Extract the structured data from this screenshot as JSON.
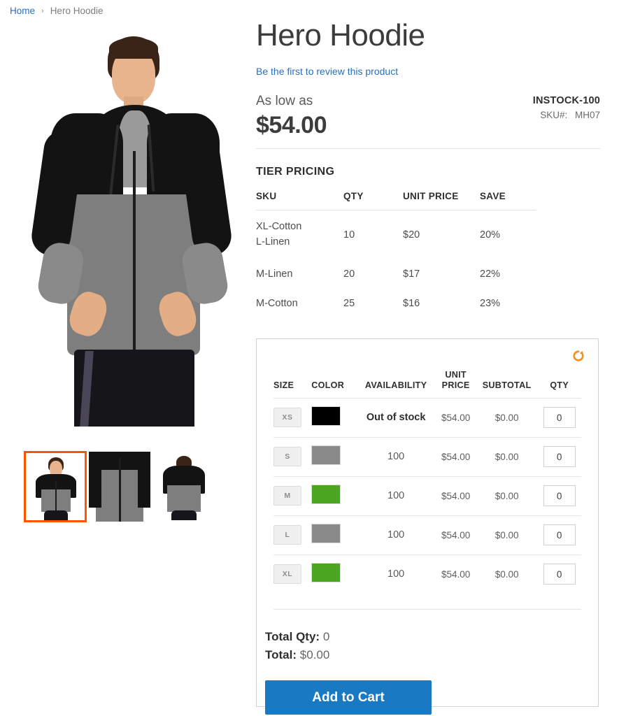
{
  "breadcrumb": {
    "home": "Home",
    "separator": "›",
    "current": "Hero Hoodie"
  },
  "product": {
    "title": "Hero Hoodie",
    "review_link": "Be the first to review this product",
    "as_low_as_label": "As low as",
    "price": "$54.00",
    "stock_status": "INSTOCK-100",
    "sku_key": "SKU#:",
    "sku_value": "MH07"
  },
  "gallery": {
    "thumbnails": [
      {
        "name": "hero-hoodie-front-model",
        "active": true
      },
      {
        "name": "hero-hoodie-detail-zipper",
        "active": false
      },
      {
        "name": "hero-hoodie-back-model",
        "active": false
      }
    ]
  },
  "tier_pricing": {
    "heading": "TIER PRICING",
    "columns": [
      "SKU",
      "QTY",
      "UNIT PRICE",
      "SAVE"
    ],
    "rows": [
      {
        "sku_lines": [
          "XL-Cotton",
          "L-Linen"
        ],
        "qty": "10",
        "unit_price": "$20",
        "save": "20%"
      },
      {
        "sku_lines": [
          "M-Linen"
        ],
        "qty": "20",
        "unit_price": "$17",
        "save": "22%"
      },
      {
        "sku_lines": [
          "M-Cotton"
        ],
        "qty": "25",
        "unit_price": "$16",
        "save": "23%"
      }
    ]
  },
  "grouped_products": {
    "refresh_icon": "refresh-icon",
    "columns": {
      "size": "SIZE",
      "color": "COLOR",
      "availability": "AVAILABILITY",
      "unit_price_line1": "UNIT",
      "unit_price_line2": "PRICE",
      "subtotal": "SUBTOTAL",
      "qty": "QTY"
    },
    "rows": [
      {
        "size": "XS",
        "color_hex": "#000000",
        "color_name": "black",
        "availability": "Out of stock",
        "out_of_stock": true,
        "unit_price": "$54.00",
        "subtotal": "$0.00",
        "qty": "0"
      },
      {
        "size": "S",
        "color_hex": "#8a8a8a",
        "color_name": "gray",
        "availability": "100",
        "out_of_stock": false,
        "unit_price": "$54.00",
        "subtotal": "$0.00",
        "qty": "0"
      },
      {
        "size": "M",
        "color_hex": "#4ca520",
        "color_name": "green",
        "availability": "100",
        "out_of_stock": false,
        "unit_price": "$54.00",
        "subtotal": "$0.00",
        "qty": "0"
      },
      {
        "size": "L",
        "color_hex": "#8a8a8a",
        "color_name": "gray",
        "availability": "100",
        "out_of_stock": false,
        "unit_price": "$54.00",
        "subtotal": "$0.00",
        "qty": "0"
      },
      {
        "size": "XL",
        "color_hex": "#4ca520",
        "color_name": "green",
        "availability": "100",
        "out_of_stock": false,
        "unit_price": "$54.00",
        "subtotal": "$0.00",
        "qty": "0"
      }
    ],
    "totals": {
      "total_qty_label": "Total Qty:",
      "total_qty_value": "0",
      "total_label": "Total:",
      "total_value": "$0.00"
    },
    "add_to_cart_label": "Add to Cart"
  },
  "colors": {
    "link": "#2a6fba",
    "accent_orange": "#ff5501",
    "button_blue": "#1979c3",
    "text_dark": "#3c3c3c"
  }
}
